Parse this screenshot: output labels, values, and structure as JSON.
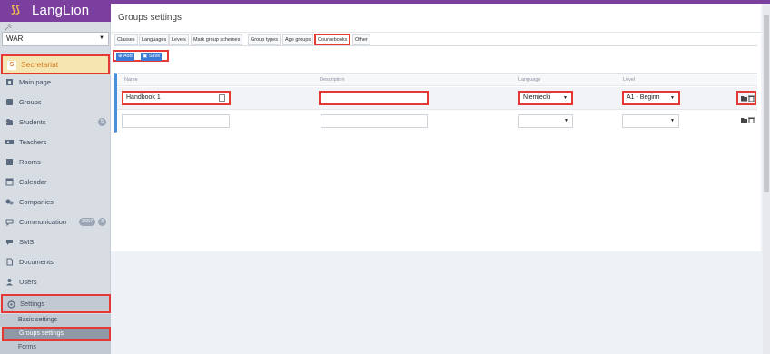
{
  "app": {
    "logo_text": "LangLion"
  },
  "sidebar": {
    "branch_select": "WAR",
    "secretariat": {
      "badge": "S",
      "label": "Secretariat"
    },
    "items": [
      {
        "label": "Main page",
        "icon": "home-icon"
      },
      {
        "label": "Groups",
        "icon": "groups-icon"
      },
      {
        "label": "Students",
        "icon": "students-icon",
        "badge": "5"
      },
      {
        "label": "Teachers",
        "icon": "teachers-icon"
      },
      {
        "label": "Rooms",
        "icon": "rooms-icon"
      },
      {
        "label": "Calendar",
        "icon": "calendar-icon"
      },
      {
        "label": "Companies",
        "icon": "companies-icon"
      },
      {
        "label": "Communication",
        "icon": "communication-icon",
        "badge": "3657",
        "badge2": "3"
      },
      {
        "label": "SMS",
        "icon": "sms-icon"
      },
      {
        "label": "Documents",
        "icon": "documents-icon"
      },
      {
        "label": "Users",
        "icon": "users-icon"
      }
    ],
    "settings": {
      "label": "Settings"
    },
    "sub_items": [
      {
        "label": "Basic settings"
      },
      {
        "label": "Groups settings"
      },
      {
        "label": "Forms"
      }
    ]
  },
  "main": {
    "title": "Groups settings",
    "tabs": [
      {
        "label": "Classes"
      },
      {
        "label": "Languages"
      },
      {
        "label": "Levels"
      },
      {
        "label": "Mark group schemes"
      },
      {
        "label": "Group types"
      },
      {
        "label": "Age groups"
      },
      {
        "label": "Coursebooks",
        "active": true
      },
      {
        "label": "Other"
      }
    ],
    "buttons": {
      "add": "Add",
      "save": "Save"
    },
    "table": {
      "columns": [
        "Name",
        "Description",
        "Language",
        "Level"
      ],
      "rows": [
        {
          "name": "Handbook 1",
          "description": "",
          "language": "Niemiecki",
          "level": "A1 - Beginn"
        },
        {
          "name": "",
          "description": "",
          "language": "",
          "level": ""
        }
      ]
    }
  },
  "colors": {
    "brand": "#7b3f9e",
    "accent": "#3a7bd5",
    "highlight": "#e53935"
  }
}
